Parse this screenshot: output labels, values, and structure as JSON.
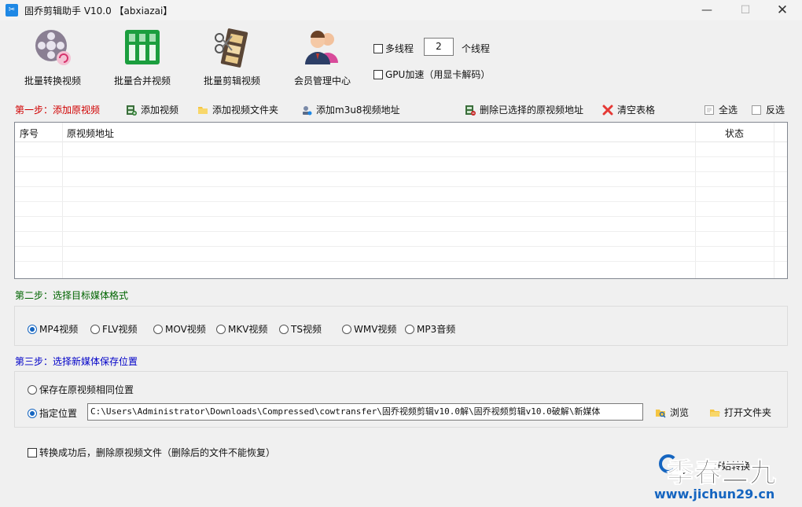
{
  "window": {
    "title": "固乔剪辑助手 V10.0  【abxiazai】",
    "minimize": "—",
    "maximize": "☐",
    "close": "✕"
  },
  "toolbar": {
    "batch_convert": "批量转换视频",
    "batch_merge": "批量合并视频",
    "batch_cut": "批量剪辑视频",
    "member_center": "会员管理中心"
  },
  "options": {
    "multithread_label": "多线程",
    "thread_count": "2",
    "thread_unit": "个线程",
    "gpu_label": "GPU加速（用显卡解码）"
  },
  "step1": {
    "label": "第一步：添加原视频",
    "add_video": "添加视频",
    "add_folder": "添加视频文件夹",
    "add_m3u8": "添加m3u8视频地址",
    "delete_selected": "删除已选择的原视频地址",
    "clear_table": "清空表格",
    "select_all": "全选",
    "invert_select": "反选"
  },
  "table": {
    "columns": [
      "序号",
      "原视频地址",
      "状态"
    ],
    "rows": []
  },
  "step2": {
    "label": "第二步：选择目标媒体格式",
    "formats": [
      "MP4视频",
      "FLV视频",
      "MOV视频",
      "MKV视频",
      "TS视频",
      "WMV视频",
      "MP3音频"
    ],
    "selected": "MP4视频"
  },
  "step3": {
    "label": "第三步：选择新媒体保存位置",
    "same_location": "保存在原视频相同位置",
    "specify_location": "指定位置",
    "path": "C:\\Users\\Administrator\\Downloads\\Compressed\\cowtransfer\\固乔视频剪辑v10.0解\\固乔视频剪辑v10.0破解\\新媒体",
    "browse": "浏览",
    "open_folder": "打开文件夹"
  },
  "footer": {
    "delete_after": "转换成功后，删除原视频文件（删除后的文件不能恢复）",
    "start": "开始转换"
  },
  "watermark": {
    "text": "季春二九",
    "url": "www.jichun29.cn"
  },
  "colors": {
    "step1": "#d00000",
    "step2": "#006400",
    "step3": "#0000c8",
    "accent": "#1565c0"
  }
}
